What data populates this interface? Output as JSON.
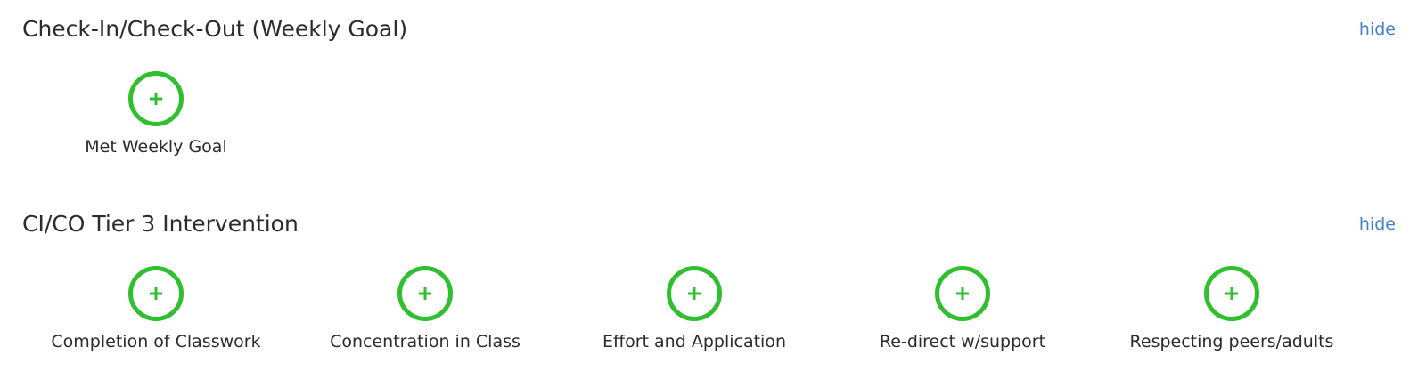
{
  "sections": [
    {
      "title": "Check-In/Check-Out (Weekly Goal)",
      "hide_label": "hide",
      "behaviors": [
        {
          "label": "Met Weekly Goal",
          "icon": "plus-circle-icon"
        }
      ]
    },
    {
      "title": "CI/CO Tier 3 Intervention",
      "hide_label": "hide",
      "behaviors": [
        {
          "label": "Completion of Classwork",
          "icon": "plus-circle-icon"
        },
        {
          "label": "Concentration in Class",
          "icon": "plus-circle-icon"
        },
        {
          "label": "Effort and Application",
          "icon": "plus-circle-icon"
        },
        {
          "label": "Re-direct w/support",
          "icon": "plus-circle-icon"
        },
        {
          "label": "Respecting peers/adults",
          "icon": "plus-circle-icon"
        }
      ]
    }
  ],
  "colors": {
    "accent_green": "#2fbf2f",
    "link_blue": "#3f7fd0",
    "text": "#2b2b2b"
  }
}
